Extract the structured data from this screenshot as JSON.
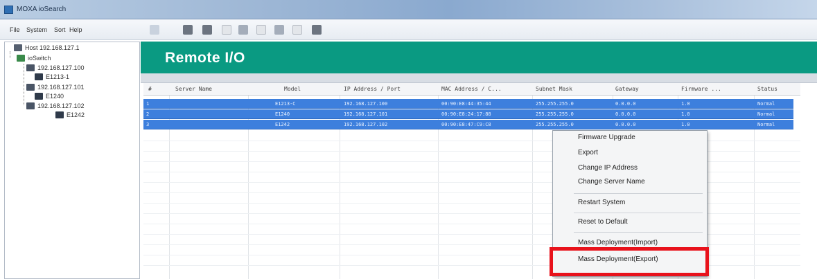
{
  "window": {
    "title": "MOXA ioSearch"
  },
  "menu": {
    "items": [
      "File",
      "System",
      "Sort",
      "Help"
    ]
  },
  "toolbar": {
    "icons": [
      "back-icon",
      "device-icon",
      "device-dark-icon",
      "wrench-icon",
      "config-icon",
      "monitor-icon",
      "upload-icon",
      "settings-icon",
      "server-icon"
    ]
  },
  "tree": {
    "host": "Host 192.168.127.1",
    "switch": "ioSwitch",
    "nodes": [
      {
        "ip": "192.168.127.100",
        "device": "E1213-1"
      },
      {
        "ip": "192.168.127.101",
        "device": "E1240"
      },
      {
        "ip": "192.168.127.102",
        "device": "E1242"
      }
    ]
  },
  "panel": {
    "title": "Remote I/O"
  },
  "table": {
    "columns": [
      "#",
      "Server Name",
      "Model",
      "IP Address / Port",
      "MAC Address / C...",
      "Subnet Mask",
      "Gateway",
      "Firmware ...",
      "Status"
    ],
    "rows": [
      [
        "1",
        "",
        "E1213-C",
        "192.168.127.100",
        "00:90:E8:44:35:44",
        "255.255.255.0",
        "0.0.0.0",
        "1.0",
        "Normal"
      ],
      [
        "2",
        "",
        "E1240",
        "192.168.127.101",
        "00:90:E8:24:17:88",
        "255.255.255.0",
        "0.0.0.0",
        "1.0",
        "Normal"
      ],
      [
        "3",
        "",
        "E1242",
        "192.168.127.102",
        "00:90:E8:47:C9:C8",
        "255.255.255.0",
        "0.0.0.0",
        "1.0",
        "Normal"
      ]
    ]
  },
  "context_menu": {
    "items": [
      "Firmware Upgrade",
      "Export",
      "Change IP Address",
      "Change Server Name",
      "Restart System",
      "Reset to Default",
      "Mass Deployment(Import)",
      "Mass Deployment(Export)"
    ]
  },
  "colors": {
    "header": "#0a9a82",
    "selection": "#3d7fdd",
    "highlight": "#e8121b"
  }
}
